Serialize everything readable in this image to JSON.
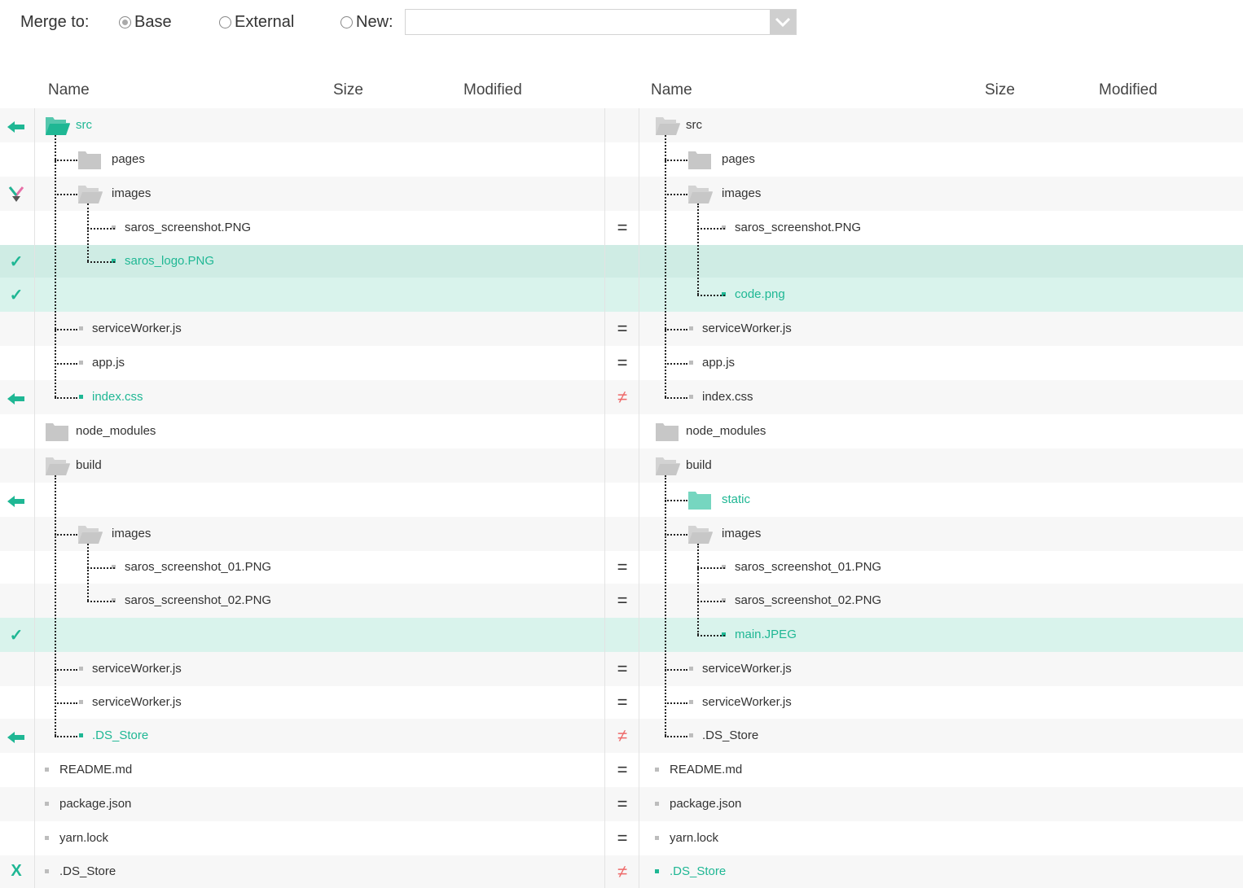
{
  "merge": {
    "label": "Merge to:",
    "options": [
      {
        "label": "Base",
        "selected": true
      },
      {
        "label": "External",
        "selected": false
      },
      {
        "label": "New:",
        "selected": false
      }
    ],
    "new_path_value": ""
  },
  "columns": {
    "left": {
      "name": "Name",
      "size": "Size",
      "modified": "Modified"
    },
    "right": {
      "name": "Name",
      "size": "Size",
      "modified": "Modified"
    }
  },
  "colors": {
    "accent": "#1fb794",
    "diff": "#ee6a6a",
    "folder": "#c7c7c7",
    "selected_row": "#cfece4"
  },
  "rows": [
    {
      "action": "arrow-left",
      "compare": "",
      "left": {
        "name": "src",
        "type": "folder-open",
        "green": true
      },
      "right": {
        "name": "src",
        "type": "folder-open"
      }
    },
    {
      "action": "",
      "compare": "",
      "left": {
        "name": "pages",
        "type": "folder"
      },
      "right": {
        "name": "pages",
        "type": "folder"
      }
    },
    {
      "action": "merge",
      "compare": "",
      "left": {
        "name": "images",
        "type": "folder-open"
      },
      "right": {
        "name": "images",
        "type": "folder-open"
      }
    },
    {
      "action": "",
      "compare": "=",
      "left": {
        "name": "saros_screenshot.PNG",
        "type": "file"
      },
      "right": {
        "name": "saros_screenshot.PNG",
        "type": "file"
      }
    },
    {
      "action": "check",
      "compare": "",
      "left": {
        "name": "saros_logo.PNG",
        "type": "file",
        "green": true
      },
      "right": null
    },
    {
      "action": "check",
      "compare": "",
      "left": null,
      "right": {
        "name": "code.png",
        "type": "file",
        "green": true
      }
    },
    {
      "action": "",
      "compare": "=",
      "left": {
        "name": "serviceWorker.js",
        "type": "file"
      },
      "right": {
        "name": "serviceWorker.js",
        "type": "file"
      }
    },
    {
      "action": "",
      "compare": "=",
      "left": {
        "name": "app.js",
        "type": "file"
      },
      "right": {
        "name": "app.js",
        "type": "file"
      }
    },
    {
      "action": "arrow-left",
      "compare": "≠",
      "left": {
        "name": "index.css",
        "type": "file",
        "green": true
      },
      "right": {
        "name": "index.css",
        "type": "file"
      }
    },
    {
      "action": "",
      "compare": "",
      "left": {
        "name": "node_modules",
        "type": "folder"
      },
      "right": {
        "name": "node_modules",
        "type": "folder"
      }
    },
    {
      "action": "",
      "compare": "",
      "left": {
        "name": "build",
        "type": "folder-open"
      },
      "right": {
        "name": "build",
        "type": "folder-open"
      }
    },
    {
      "action": "arrow-left",
      "compare": "",
      "left": null,
      "right": {
        "name": "static",
        "type": "folder",
        "green": true
      }
    },
    {
      "action": "",
      "compare": "",
      "left": {
        "name": "images",
        "type": "folder-open"
      },
      "right": {
        "name": "images",
        "type": "folder-open"
      }
    },
    {
      "action": "",
      "compare": "=",
      "left": {
        "name": "saros_screenshot_01.PNG",
        "type": "file"
      },
      "right": {
        "name": "saros_screenshot_01.PNG",
        "type": "file"
      }
    },
    {
      "action": "",
      "compare": "=",
      "left": {
        "name": "saros_screenshot_02.PNG",
        "type": "file"
      },
      "right": {
        "name": "saros_screenshot_02.PNG",
        "type": "file"
      }
    },
    {
      "action": "check",
      "compare": "",
      "left": null,
      "right": {
        "name": "main.JPEG",
        "type": "file",
        "green": true
      }
    },
    {
      "action": "",
      "compare": "=",
      "left": {
        "name": "serviceWorker.js",
        "type": "file"
      },
      "right": {
        "name": "serviceWorker.js",
        "type": "file"
      }
    },
    {
      "action": "",
      "compare": "=",
      "left": {
        "name": "serviceWorker.js",
        "type": "file"
      },
      "right": {
        "name": "serviceWorker.js",
        "type": "file"
      }
    },
    {
      "action": "arrow-left",
      "compare": "≠",
      "left": {
        "name": ".DS_Store",
        "type": "file",
        "green": true
      },
      "right": {
        "name": ".DS_Store",
        "type": "file"
      }
    },
    {
      "action": "",
      "compare": "=",
      "left": {
        "name": "README.md",
        "type": "file"
      },
      "right": {
        "name": "README.md",
        "type": "file"
      }
    },
    {
      "action": "",
      "compare": "=",
      "left": {
        "name": "package.json",
        "type": "file"
      },
      "right": {
        "name": "package.json",
        "type": "file"
      }
    },
    {
      "action": "",
      "compare": "=",
      "left": {
        "name": "yarn.lock",
        "type": "file"
      },
      "right": {
        "name": "yarn.lock",
        "type": "file"
      }
    },
    {
      "action": "X",
      "compare": "≠",
      "left": {
        "name": ".DS_Store",
        "type": "file"
      },
      "right": {
        "name": ".DS_Store",
        "type": "file",
        "green": true
      }
    }
  ]
}
